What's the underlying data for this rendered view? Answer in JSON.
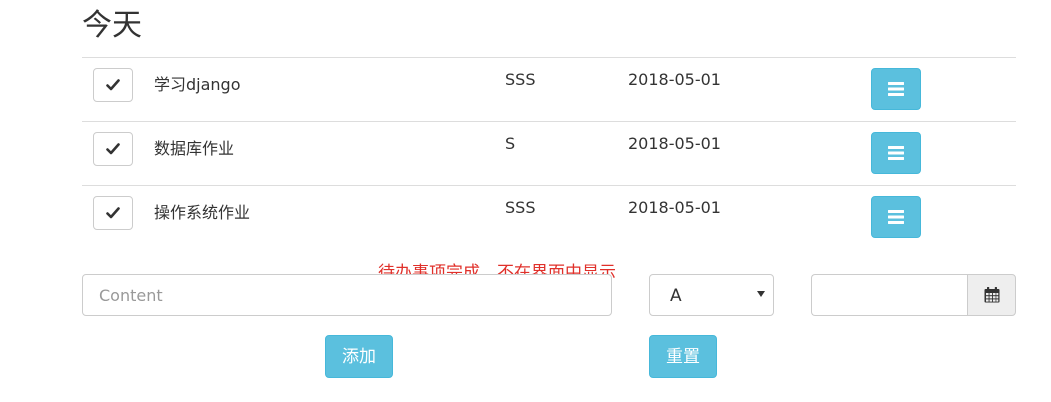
{
  "page": {
    "heading": "今天",
    "annotation": "待办事项完成，不在界面中显示"
  },
  "tasks": [
    {
      "content": "学习django",
      "priority": "SSS",
      "date": "2018-05-01"
    },
    {
      "content": "数据库作业",
      "priority": "S",
      "date": "2018-05-01"
    },
    {
      "content": "操作系统作业",
      "priority": "SSS",
      "date": "2018-05-01"
    }
  ],
  "form": {
    "content_placeholder": "Content",
    "content_value": "",
    "priority_selected": "A",
    "date_value": "",
    "add_label": "添加",
    "reset_label": "重置"
  },
  "icons": {
    "check": "check-icon",
    "menu": "list-icon",
    "calendar": "calendar-icon"
  },
  "colors": {
    "button_info": "#5bc0de",
    "annotation": "#e0302a",
    "border": "#cccccc"
  }
}
